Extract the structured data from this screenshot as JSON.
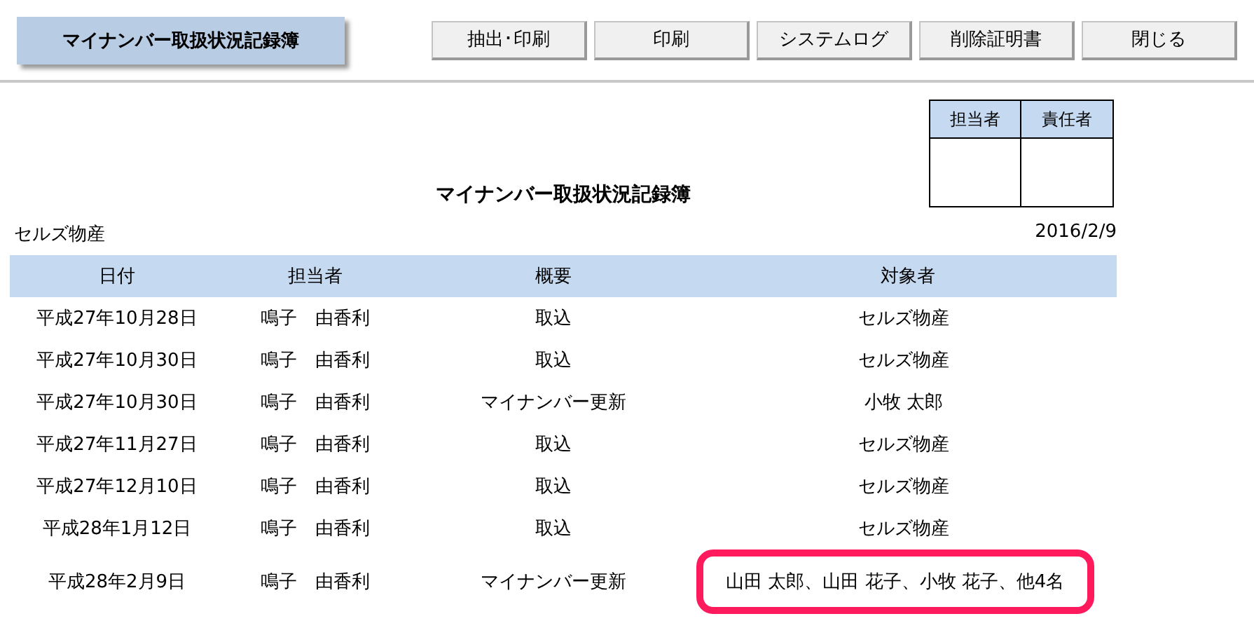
{
  "header": {
    "title": "マイナンバー取扱状況記録簿",
    "buttons": [
      "抽出･印刷",
      "印刷",
      "システムログ",
      "削除証明書",
      "閉じる"
    ]
  },
  "stamp_box": {
    "columns": [
      "担当者",
      "責任者"
    ]
  },
  "report": {
    "title": "マイナンバー取扱状況記録簿",
    "company": "セルズ物産",
    "date": "2016/2/9"
  },
  "table": {
    "columns": [
      "日付",
      "担当者",
      "概要",
      "対象者"
    ],
    "rows": [
      {
        "cells": [
          "平成27年10月28日",
          "鳴子　由香利",
          "取込",
          "セルズ物産"
        ],
        "highlighted": false
      },
      {
        "cells": [
          "平成27年10月30日",
          "鳴子　由香利",
          "取込",
          "セルズ物産"
        ],
        "highlighted": false
      },
      {
        "cells": [
          "平成27年10月30日",
          "鳴子　由香利",
          "マイナンバー更新",
          "小牧 太郎"
        ],
        "highlighted": false
      },
      {
        "cells": [
          "平成27年11月27日",
          "鳴子　由香利",
          "取込",
          "セルズ物産"
        ],
        "highlighted": false
      },
      {
        "cells": [
          "平成27年12月10日",
          "鳴子　由香利",
          "取込",
          "セルズ物産"
        ],
        "highlighted": false
      },
      {
        "cells": [
          "平成28年1月12日",
          "鳴子　由香利",
          "取込",
          "セルズ物産"
        ],
        "highlighted": false
      },
      {
        "cells": [
          "平成28年2月9日",
          "鳴子　由香利",
          "マイナンバー更新",
          "山田 太郎、山田 花子、小牧 花子、他4名"
        ],
        "highlighted": true
      }
    ]
  }
}
